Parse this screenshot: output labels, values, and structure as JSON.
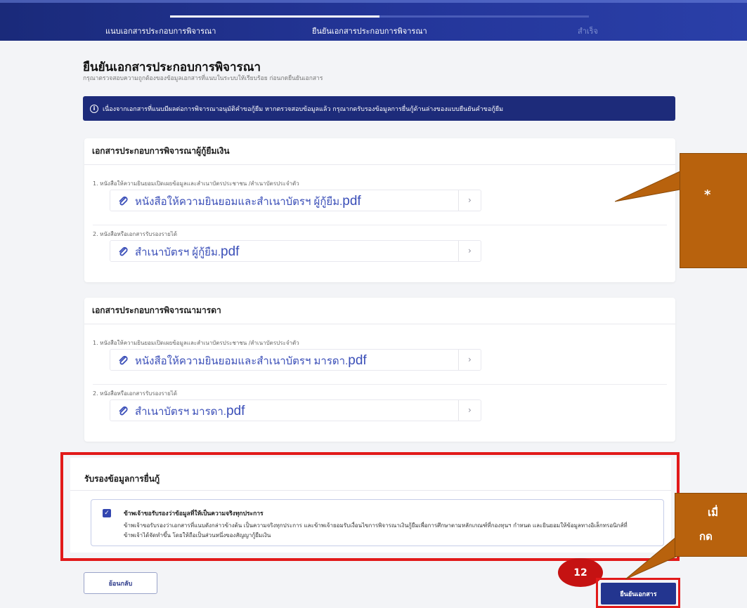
{
  "stepper": {
    "steps": [
      {
        "label": "แนบเอกสารประกอบการพิจารณา",
        "state": "done"
      },
      {
        "label": "ยืนยันเอกสารประกอบการพิจารณา",
        "state": "active"
      },
      {
        "label": "สำเร็จ",
        "state": "pending"
      }
    ]
  },
  "page": {
    "title": "ยืนยันเอกสารประกอบการพิจารณา",
    "subtitle": "กรุณาตรวจสอบความถูกต้องของข้อมูลเอกสารที่แนบในระบบให้เรียบร้อย ก่อนกดยืนยันเอกสาร"
  },
  "notice": {
    "icon": "info-icon",
    "text": "เนื่องจากเอกสารที่แนบมีผลต่อการพิจารณาอนุมัติคำขอกู้ยืม หากตรวจสอบข้อมูลแล้ว กรุณากดรับรองข้อมูลการยื่นกู้ด้านล่างของแบบยืนยันคำขอกู้ยืม"
  },
  "sections": [
    {
      "title": "เอกสารประกอบการพิจารณาผู้กู้ยืมเงิน",
      "docs": [
        {
          "label": "1. หนังสือให้ความยินยอมเปิดเผยข้อมูลและสำเนาบัตรประชาชน /สำเนาบัตรประจำตัว",
          "file_name": "หนังสือให้ความยินยอมและสำเนาบัตรฯ ผู้กู้ยืม.",
          "file_ext": "pdf"
        },
        {
          "label": "2. หนังสือหรือเอกสารรับรองรายได้",
          "file_name": "สำเนาบัตรฯ ผู้กู้ยืม.",
          "file_ext": "pdf"
        }
      ]
    },
    {
      "title": "เอกสารประกอบการพิจารณามารดา",
      "docs": [
        {
          "label": "1. หนังสือให้ความยินยอมเปิดเผยข้อมูลและสำเนาบัตรประชาชน /สำเนาบัตรประจำตัว",
          "file_name": "หนังสือให้ความยินยอมและสำเนาบัตรฯ มารดา.",
          "file_ext": "pdf"
        },
        {
          "label": "2. หนังสือหรือเอกสารรับรองรายได้",
          "file_name": "สำเนาบัตรฯ มารดา.",
          "file_ext": "pdf"
        }
      ]
    }
  ],
  "certification": {
    "title": "รับรองข้อมูลการยื่นกู้",
    "checked": true,
    "heading": "ข้าพเจ้าขอรับรองว่าข้อมูลที่ให้เป็นความจริงทุกประการ",
    "body": "ข้าพเจ้าขอรับรองว่าเอกสารที่แนบดังกล่าวข้างต้น เป็นความจริงทุกประการ และข้าพเจ้ายอมรับเงื่อนไขการพิจารณาเงินกู้ยืมเพื่อการศึกษาตามหลักเกณฑ์ที่กองทุนฯ กำหนด และยินยอมให้ข้อมูลทางอิเล็กทรอนิกส์ที่ข้าพเจ้าได้จัดทำขึ้น โดยให้ถือเป็นส่วนหนึ่งของสัญญากู้ยืมเงิน"
  },
  "footer": {
    "back_label": "ย้อนกลับ",
    "confirm_label": "ยืนยันเอกสาร"
  },
  "annotations": {
    "step_number": "12",
    "callout_top_text": "*",
    "callout_bottom_line1": "เมื่",
    "callout_bottom_line2": "กด",
    "callout_color": "#b8620d",
    "highlight_color": "#e21a1a"
  },
  "colors": {
    "navy": "#1d2b7a",
    "accent": "#3346b0",
    "link": "#3b4fb8"
  }
}
